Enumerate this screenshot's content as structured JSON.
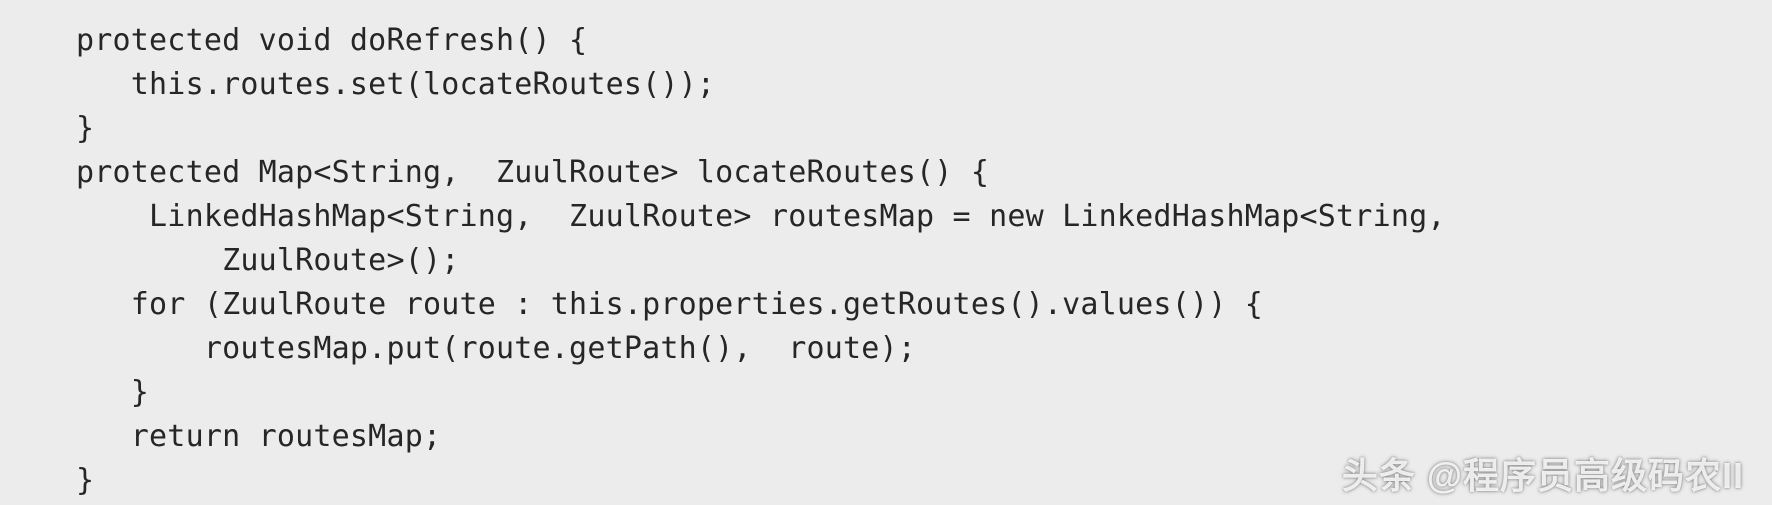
{
  "code": {
    "lines": [
      "protected void doRefresh() {",
      "   this.routes.set(locateRoutes());",
      "}",
      "protected Map<String,  ZuulRoute> locateRoutes() {",
      "    LinkedHashMap<String,  ZuulRoute> routesMap = new LinkedHashMap<String,",
      "        ZuulRoute>();",
      "   for (ZuulRoute route : this.properties.getRoutes().values()) {",
      "       routesMap.put(route.getPath(),  route);",
      "   }",
      "   return routesMap;",
      "}"
    ]
  },
  "watermark": {
    "text": "头条 @程序员高级码农II"
  }
}
